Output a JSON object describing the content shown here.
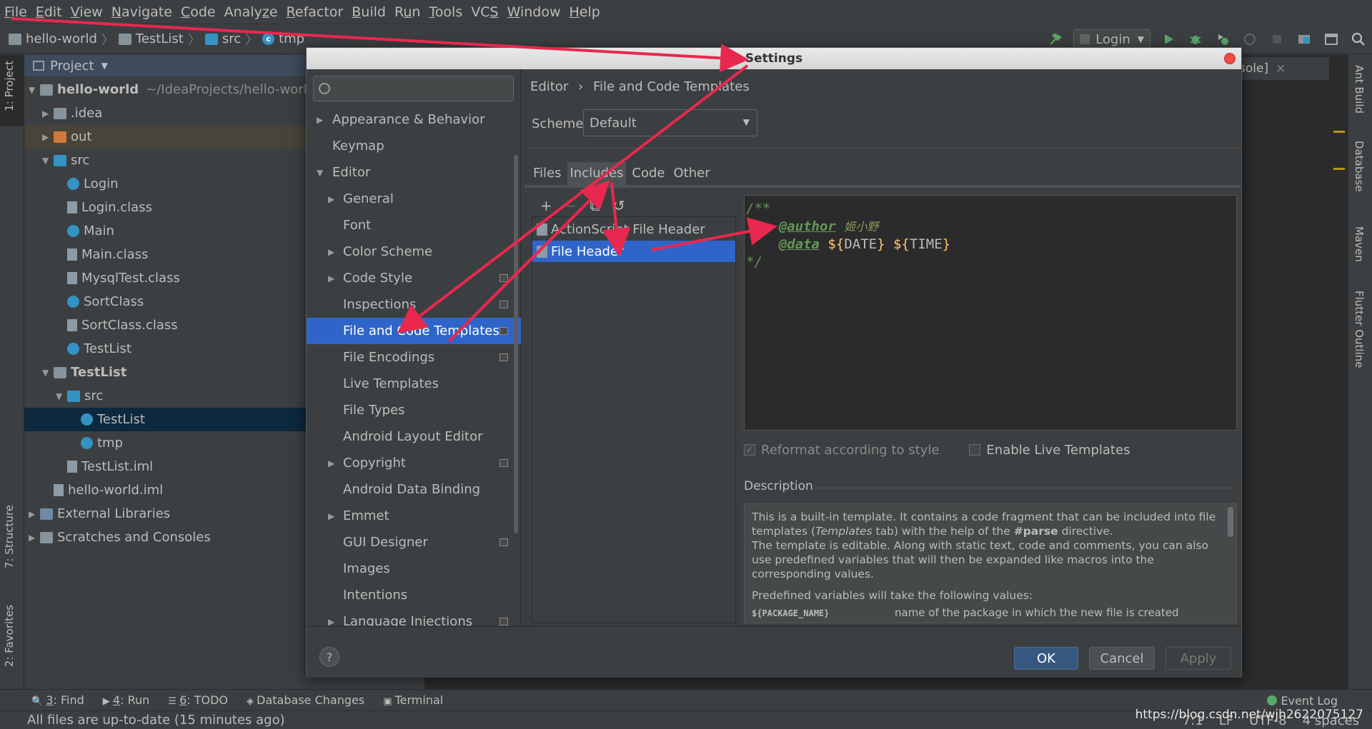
{
  "menu": [
    {
      "label": "File",
      "mnemonic": "F"
    },
    {
      "label": "Edit",
      "mnemonic": "E"
    },
    {
      "label": "View",
      "mnemonic": "V"
    },
    {
      "label": "Navigate",
      "mnemonic": "N"
    },
    {
      "label": "Code",
      "mnemonic": "C"
    },
    {
      "label": "Analyze",
      "mnemonic": "z"
    },
    {
      "label": "Refactor",
      "mnemonic": "R"
    },
    {
      "label": "Build",
      "mnemonic": "B"
    },
    {
      "label": "Run",
      "mnemonic": "u"
    },
    {
      "label": "Tools",
      "mnemonic": "T"
    },
    {
      "label": "VCS",
      "mnemonic": "S"
    },
    {
      "label": "Window",
      "mnemonic": "W"
    },
    {
      "label": "Help",
      "mnemonic": "H"
    }
  ],
  "navbar": {
    "crumbs": [
      "hello-world",
      "TestList",
      "src",
      "tmp"
    ],
    "run_config": "Login"
  },
  "left_stripe": {
    "project_tab": "1: Project",
    "structure_tab": "7: Structure",
    "favorites_tab": "2: Favorites"
  },
  "right_stripe": {
    "ant": "Ant Build",
    "database": "Database",
    "maven": "Maven",
    "flutter": "Flutter Outline"
  },
  "project": {
    "header": "Project",
    "tree": [
      {
        "label": "hello-world",
        "path": "~/IdeaProjects/hello-world",
        "level": 0,
        "arrow": "down",
        "icon": "module",
        "bold": true
      },
      {
        "label": ".idea",
        "level": 1,
        "arrow": "right",
        "icon": "folder"
      },
      {
        "label": "out",
        "level": 1,
        "arrow": "right",
        "icon": "folder-orange",
        "highlight": true
      },
      {
        "label": "src",
        "level": 1,
        "arrow": "down",
        "icon": "folder-blue"
      },
      {
        "label": "Login",
        "level": 2,
        "icon": "class"
      },
      {
        "label": "Login.class",
        "level": 2,
        "icon": "classfile"
      },
      {
        "label": "Main",
        "level": 2,
        "icon": "class"
      },
      {
        "label": "Main.class",
        "level": 2,
        "icon": "classfile"
      },
      {
        "label": "MysqlTest.class",
        "level": 2,
        "icon": "classfile"
      },
      {
        "label": "SortClass",
        "level": 2,
        "icon": "class"
      },
      {
        "label": "SortClass.class",
        "level": 2,
        "icon": "classfile"
      },
      {
        "label": "TestList",
        "level": 2,
        "icon": "class"
      },
      {
        "label": "TestList",
        "level": 1,
        "arrow": "down",
        "icon": "module",
        "bold": true
      },
      {
        "label": "src",
        "level": 2,
        "arrow": "down",
        "icon": "folder-blue"
      },
      {
        "label": "TestList",
        "level": 3,
        "icon": "class",
        "selected": true
      },
      {
        "label": "tmp",
        "level": 3,
        "icon": "class"
      },
      {
        "label": "TestList.iml",
        "level": 2,
        "icon": "iml"
      },
      {
        "label": "hello-world.iml",
        "level": 1,
        "icon": "iml"
      },
      {
        "label": "External Libraries",
        "level": 0,
        "arrow": "right",
        "icon": "libs"
      },
      {
        "label": "Scratches and Consoles",
        "level": 0,
        "arrow": "right",
        "icon": "scratch"
      }
    ]
  },
  "editor_tab_fragment": "sole]",
  "dialog": {
    "title": "Settings",
    "search_placeholder": "",
    "categories": [
      {
        "label": "Appearance & Behavior",
        "level": 0,
        "arrow": "right"
      },
      {
        "label": "Keymap",
        "level": 0
      },
      {
        "label": "Editor",
        "level": 0,
        "arrow": "down"
      },
      {
        "label": "General",
        "level": 1,
        "arrow": "right"
      },
      {
        "label": "Font",
        "level": 1
      },
      {
        "label": "Color Scheme",
        "level": 1,
        "arrow": "right"
      },
      {
        "label": "Code Style",
        "level": 1,
        "arrow": "right",
        "project": true
      },
      {
        "label": "Inspections",
        "level": 1,
        "project": true
      },
      {
        "label": "File and Code Templates",
        "level": 1,
        "project": true,
        "selected": true
      },
      {
        "label": "File Encodings",
        "level": 1,
        "project": true
      },
      {
        "label": "Live Templates",
        "level": 1
      },
      {
        "label": "File Types",
        "level": 1
      },
      {
        "label": "Android Layout Editor",
        "level": 1
      },
      {
        "label": "Copyright",
        "level": 1,
        "arrow": "right",
        "project": true
      },
      {
        "label": "Android Data Binding",
        "level": 1
      },
      {
        "label": "Emmet",
        "level": 1,
        "arrow": "right"
      },
      {
        "label": "GUI Designer",
        "level": 1,
        "project": true
      },
      {
        "label": "Images",
        "level": 1
      },
      {
        "label": "Intentions",
        "level": 1
      },
      {
        "label": "Language Injections",
        "level": 1,
        "arrow": "right",
        "project": true
      }
    ],
    "breadcrumb": [
      "Editor",
      "File and Code Templates"
    ],
    "scheme_label": "Scheme:",
    "scheme_value": "Default",
    "tabs": [
      "Files",
      "Includes",
      "Code",
      "Other"
    ],
    "active_tab": "Includes",
    "toolbar": [
      "+",
      "−",
      "⧉",
      "↺"
    ],
    "templates": [
      {
        "label": "ActionScript File Header"
      },
      {
        "label": "File Header",
        "selected": true
      }
    ],
    "code": {
      "open": "/**",
      "author_tag": "@author",
      "author_value": "姬小野",
      "data_tag": "@data",
      "var1": "DATE",
      "var2": "TIME",
      "close": "*/"
    },
    "reformat_label": "Reformat according to style",
    "reformat_checked": true,
    "live_label": "Enable Live Templates",
    "live_checked": false,
    "description_label": "Description",
    "description": {
      "p1a": "This is a built-in template. It contains a code fragment that can be included into file templates (",
      "p1_italic": "Templates",
      "p1b": " tab) with the help of the ",
      "p1_bold": "#parse",
      "p1c": " directive.",
      "p2": "The template is editable. Along with static text, code and comments, you can also use predefined variables that will then be expanded like macros into the corresponding values.",
      "p3": "Predefined variables will take the following values:",
      "var_name": "${PACKAGE_NAME}",
      "var_desc": "name of the package in which the new file is created"
    },
    "buttons": {
      "help": "?",
      "ok": "OK",
      "cancel": "Cancel",
      "apply": "Apply"
    }
  },
  "bottom_tools": [
    {
      "key": "3",
      "label": ": Find"
    },
    {
      "key": "4",
      "label": ": Run"
    },
    {
      "key": "6",
      "label": ": TODO"
    },
    {
      "key": "",
      "label": "Database Changes"
    },
    {
      "key": "",
      "label": "Terminal"
    }
  ],
  "event_log": "Event Log",
  "status": {
    "message": "All files are up-to-date (15 minutes ago)",
    "position": "7:1",
    "line_sep": "LF",
    "encoding": "UTF-8",
    "indent": "4 spaces",
    "watermark": "https://blog.csdn.net/wjh2622075127"
  },
  "colors": {
    "accent": "#2f65ca",
    "annotation_red": "#e8284f",
    "comment_green": "#629755",
    "template_var": "#ffc66d"
  }
}
